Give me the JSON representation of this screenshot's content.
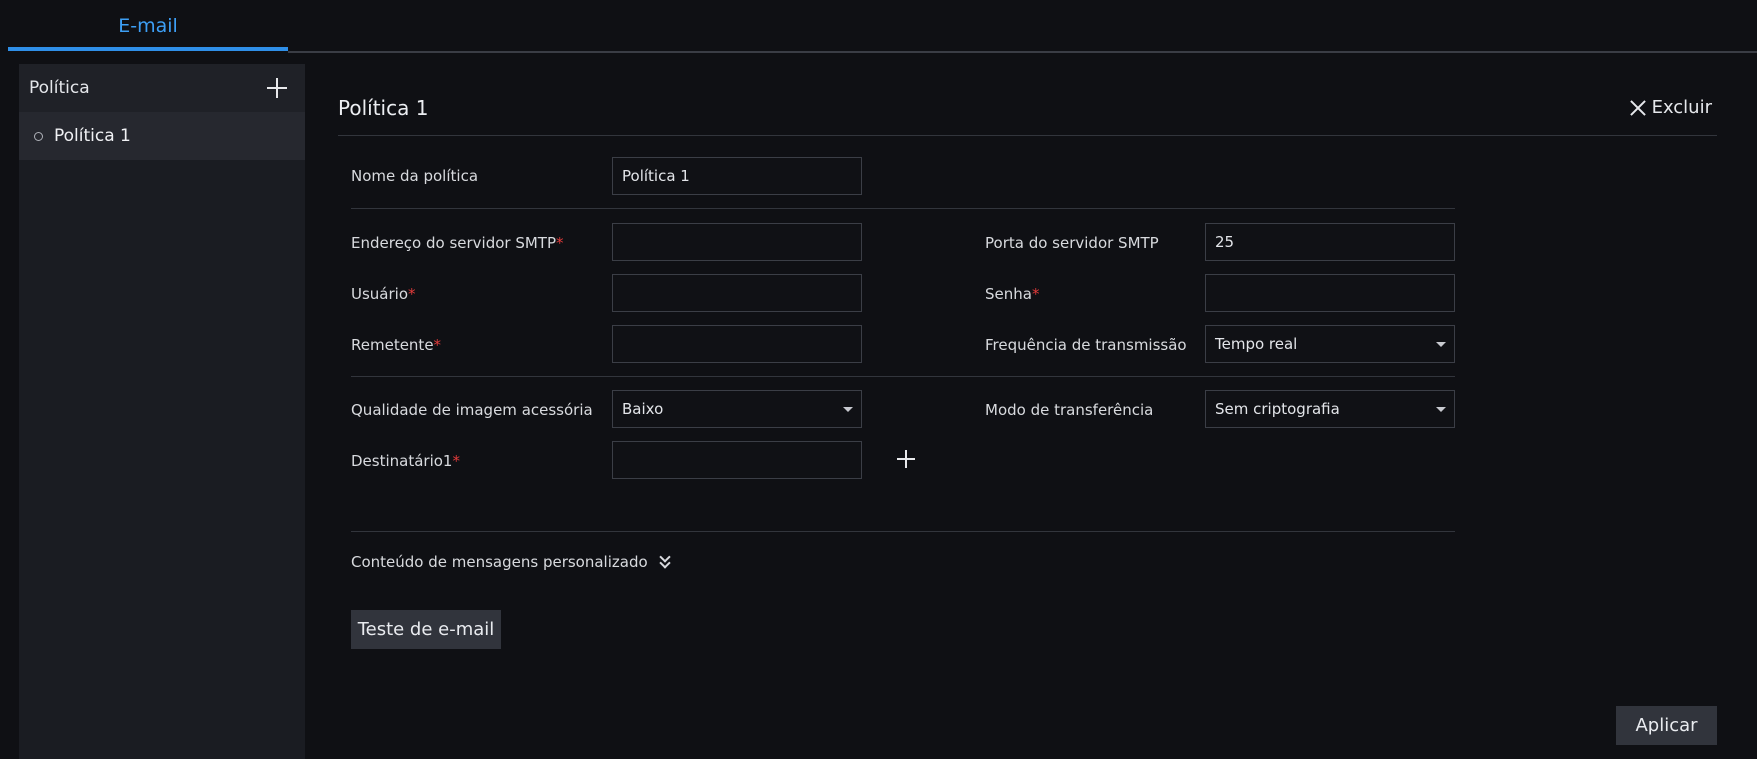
{
  "tabs": [
    {
      "label": "E-mail",
      "active": true
    }
  ],
  "sidebar": {
    "title": "Política",
    "items": [
      {
        "label": "Política 1",
        "selected": true
      }
    ]
  },
  "panel": {
    "title": "Política 1",
    "delete_label": "Excluir"
  },
  "form": {
    "policy_name": {
      "label": "Nome da política",
      "value": "Política 1"
    },
    "smtp_server": {
      "label": "Endereço do servidor SMTP",
      "required": "*",
      "value": ""
    },
    "smtp_port": {
      "label": "Porta do servidor SMTP",
      "value": "25"
    },
    "user": {
      "label": "Usuário",
      "required": "*",
      "value": ""
    },
    "password": {
      "label": "Senha",
      "required": "*",
      "value": ""
    },
    "sender": {
      "label": "Remetente",
      "required": "*",
      "value": ""
    },
    "frequency": {
      "label": "Frequência de transmissão",
      "value": "Tempo real"
    },
    "image_quality": {
      "label": "Qualidade de imagem acessória",
      "value": "Baixo"
    },
    "transfer_mode": {
      "label": "Modo de transferência",
      "value": "Sem criptografia"
    },
    "recipient1": {
      "label": "Destinatário1",
      "required": "*",
      "value": ""
    }
  },
  "custom_message_label": "Conteúdo de mensagens personalizado",
  "test_email_label": "Teste de e-mail",
  "apply_label": "Aplicar",
  "colors": {
    "accent": "#2f8fe8",
    "required": "#e23b3b",
    "background": "#0f1014"
  }
}
